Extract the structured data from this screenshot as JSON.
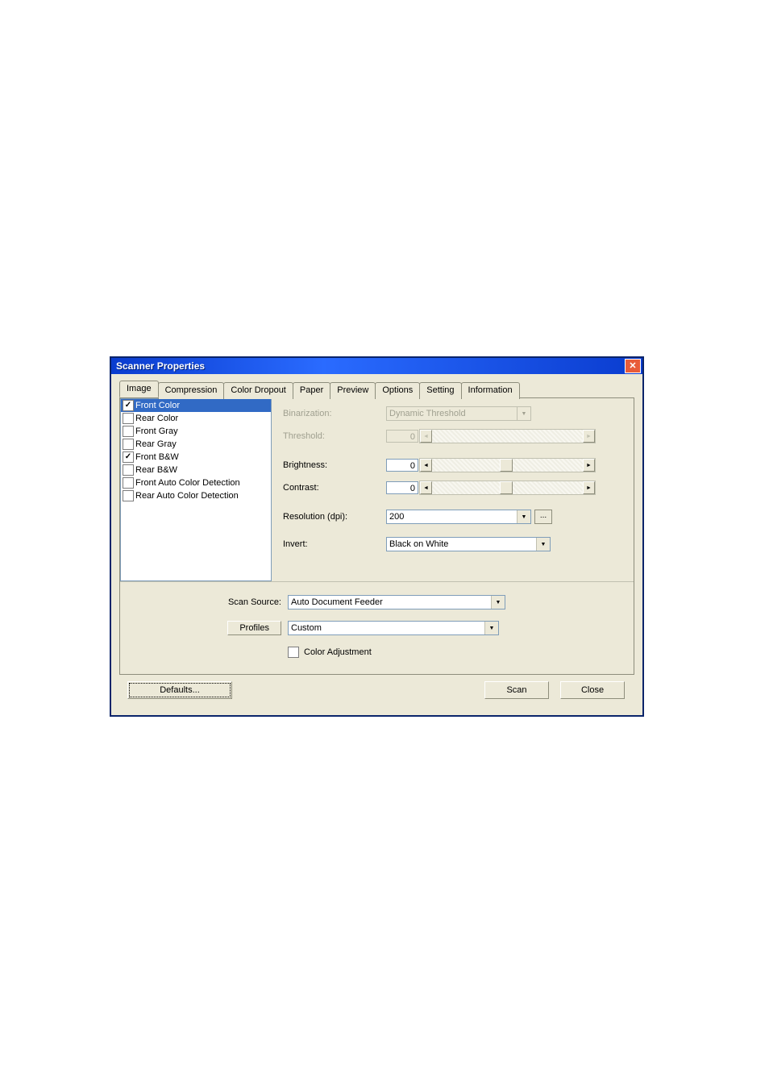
{
  "window": {
    "title": "Scanner Properties"
  },
  "tabs": [
    "Image",
    "Compression",
    "Color Dropout",
    "Paper",
    "Preview",
    "Options",
    "Setting",
    "Information"
  ],
  "active_tab": 0,
  "image_list": [
    {
      "label": "Front Color",
      "checked": true,
      "selected": true
    },
    {
      "label": "Rear Color",
      "checked": false,
      "selected": false
    },
    {
      "label": "Front Gray",
      "checked": false,
      "selected": false
    },
    {
      "label": "Rear Gray",
      "checked": false,
      "selected": false
    },
    {
      "label": "Front B&W",
      "checked": true,
      "selected": false
    },
    {
      "label": "Rear B&W",
      "checked": false,
      "selected": false
    },
    {
      "label": "Front Auto Color Detection",
      "checked": false,
      "selected": false
    },
    {
      "label": "Rear Auto Color Detection",
      "checked": false,
      "selected": false
    }
  ],
  "form": {
    "binarization_label": "Binarization:",
    "binarization_value": "Dynamic Threshold",
    "threshold_label": "Threshold:",
    "threshold_value": "0",
    "brightness_label": "Brightness:",
    "brightness_value": "0",
    "contrast_label": "Contrast:",
    "contrast_value": "0",
    "resolution_label": "Resolution (dpi):",
    "resolution_value": "200",
    "invert_label": "Invert:",
    "invert_value": "Black on White"
  },
  "bottom": {
    "scan_source_label": "Scan Source:",
    "scan_source_value": "Auto Document Feeder",
    "profiles_label": "Profiles",
    "profiles_value": "Custom",
    "color_adjustment_label": "Color Adjustment"
  },
  "footer": {
    "defaults": "Defaults...",
    "scan": "Scan",
    "close": "Close"
  }
}
